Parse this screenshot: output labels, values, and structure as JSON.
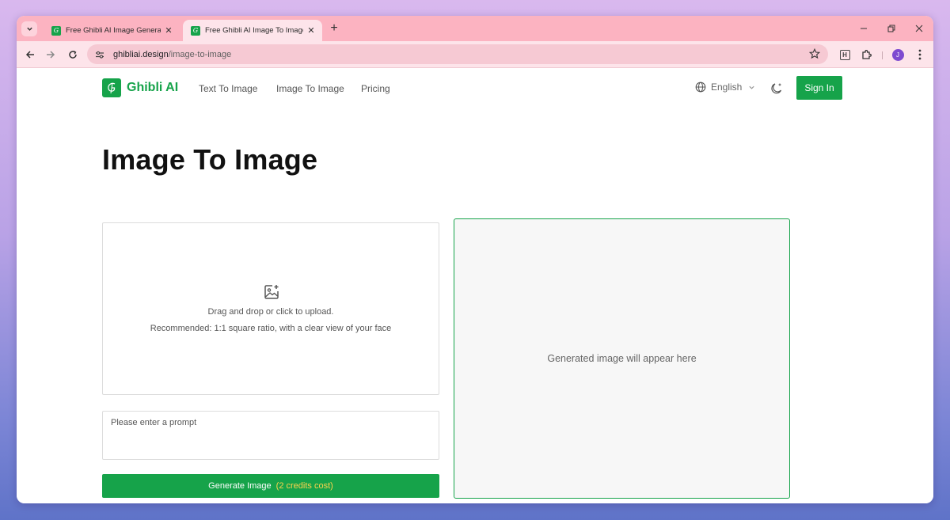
{
  "browser": {
    "tabs": [
      {
        "title": "Free Ghibli AI Image Generator",
        "active": false
      },
      {
        "title": "Free Ghibli AI Image To Image G",
        "active": true
      }
    ],
    "url_domain": "ghibliai.design",
    "url_path": "/image-to-image",
    "avatar_letter": "J",
    "extension_letter": "H"
  },
  "header": {
    "logo_text": "Ghibli AI",
    "nav": [
      "Text To Image",
      "Image To Image",
      "Pricing"
    ],
    "language": "English",
    "sign_in": "Sign In"
  },
  "main": {
    "title": "Image To Image",
    "upload": {
      "line1": "Drag and drop or click to upload.",
      "line2": "Recommended: 1:1 square ratio, with a clear view of your face"
    },
    "prompt_placeholder": "Please enter a prompt",
    "generate_label": "Generate Image",
    "generate_cost": "(2 credits cost)",
    "preview_text": "Generated image will appear here"
  },
  "colors": {
    "brand": "#16a34a",
    "tabstrip": "#fcb3c1",
    "toolbar": "#fde4ea",
    "cost_text": "#fcd34d"
  }
}
